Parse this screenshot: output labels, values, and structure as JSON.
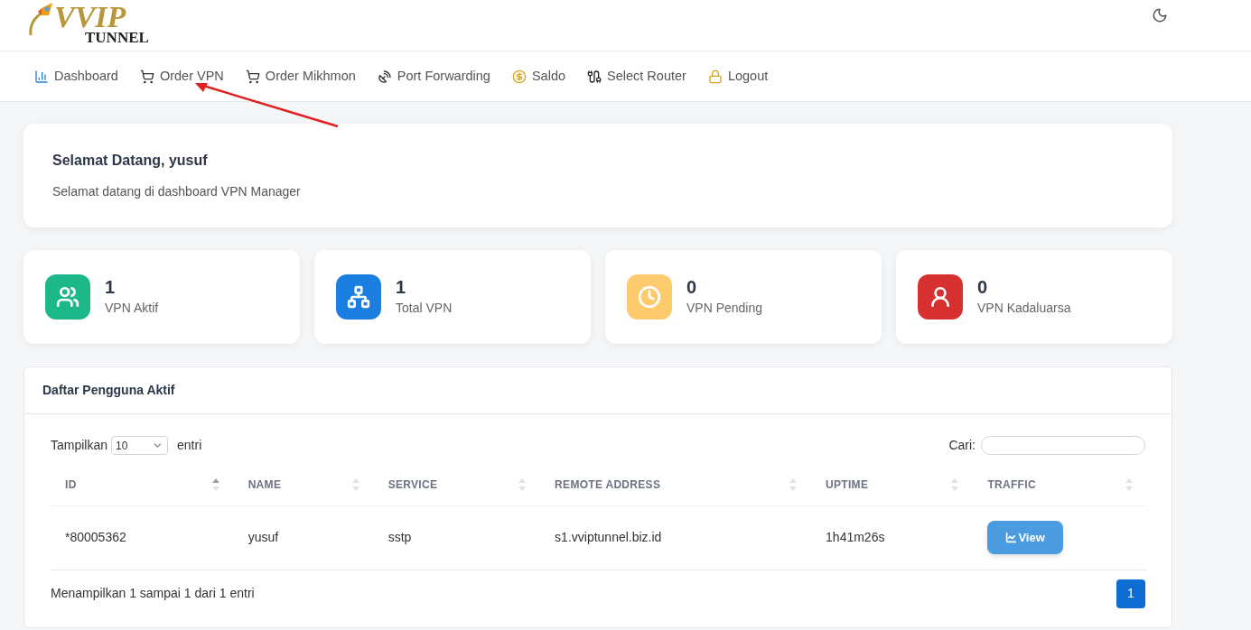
{
  "logo": {
    "word": "VVIP",
    "sub": "TUNNEL"
  },
  "nav": [
    {
      "label": "Dashboard",
      "selected": false
    },
    {
      "label": "Order VPN",
      "selected": false
    },
    {
      "label": "Order Mikhmon",
      "selected": false
    },
    {
      "label": "Port Forwarding",
      "selected": false
    },
    {
      "label": "Saldo",
      "selected": false
    },
    {
      "label": "Select Router",
      "selected": false
    },
    {
      "label": "Logout",
      "selected": false
    }
  ],
  "welcome": {
    "title": "Selamat Datang, yusuf",
    "text": "Selamat datang di dashboard VPN Manager"
  },
  "stats": [
    {
      "value": "1",
      "label": "VPN Aktif",
      "color": "#1cb88a"
    },
    {
      "value": "1",
      "label": "Total VPN",
      "color": "#1a7fe0"
    },
    {
      "value": "0",
      "label": "VPN Pending",
      "color": "#fdcb6e"
    },
    {
      "value": "0",
      "label": "VPN Kadaluarsa",
      "color": "#d63031"
    }
  ],
  "table_card": {
    "title": "Daftar Pengguna Aktif",
    "length_label": "Tampilkan",
    "length_value": "10",
    "length_suffix": "entri",
    "search_label": "Cari:",
    "columns": [
      {
        "label": "ID",
        "sorted": true
      },
      {
        "label": "NAME",
        "sorted": false
      },
      {
        "label": "SERVICE",
        "sorted": false
      },
      {
        "label": "REMOTE ADDRESS",
        "sorted": false
      },
      {
        "label": "UPTIME",
        "sorted": false
      },
      {
        "label": "TRAFFIC",
        "sorted": false
      }
    ],
    "rows": [
      {
        "id": "*80005362",
        "name": "yusuf",
        "service": "sstp",
        "remote_address": "s1.vviptunnel.biz.id",
        "uptime": "1h41m26s",
        "action": "View"
      }
    ],
    "info": "Menampilkan 1 sampai 1 dari 1 entri",
    "pages": [
      {
        "label": "1",
        "selected": true
      }
    ]
  }
}
